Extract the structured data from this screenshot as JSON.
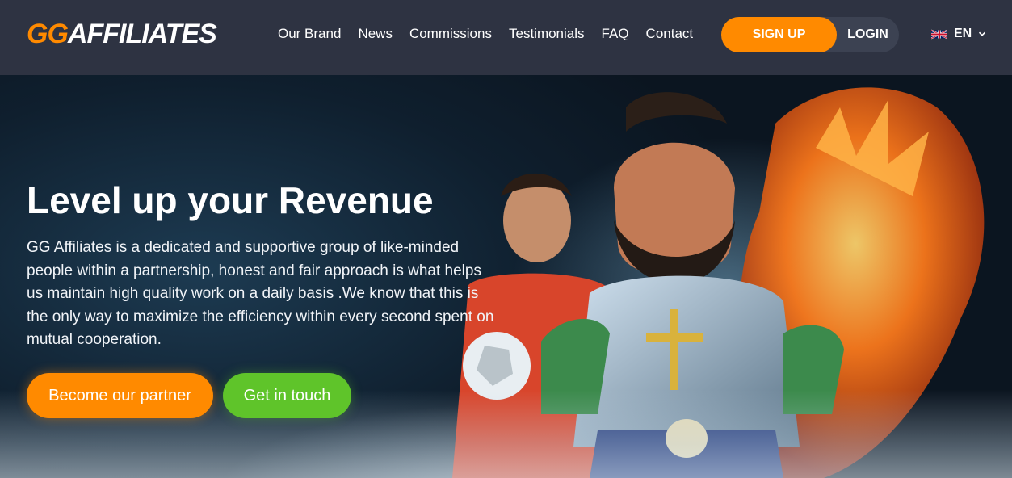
{
  "header": {
    "logo": {
      "part1": "GG",
      "part2": "AFFILIATES"
    },
    "nav": [
      {
        "label": "Our Brand"
      },
      {
        "label": "News"
      },
      {
        "label": "Commissions"
      },
      {
        "label": "Testimonials"
      },
      {
        "label": "FAQ"
      },
      {
        "label": "Contact"
      }
    ],
    "signup_label": "SIGN UP",
    "login_label": "LOGIN",
    "language": {
      "label": "EN",
      "flag_icon": "uk-flag-icon",
      "chevron_icon": "chevron-down-icon"
    }
  },
  "hero": {
    "title": "Level up your Revenue",
    "text": "GG Affiliates is a dedicated and supportive group of like-minded people within a partnership, honest and fair approach is what helps us maintain high quality work on a daily basis .We know that this is the only way to maximize the efficiency within every second spent on mutual cooperation.",
    "primary_cta": "Become our partner",
    "secondary_cta": "Get in touch"
  },
  "colors": {
    "header_bg": "#2e3342",
    "accent_orange": "#ff8a00",
    "accent_green": "#5fc42a",
    "hero_bg": "#0f1f2e"
  }
}
